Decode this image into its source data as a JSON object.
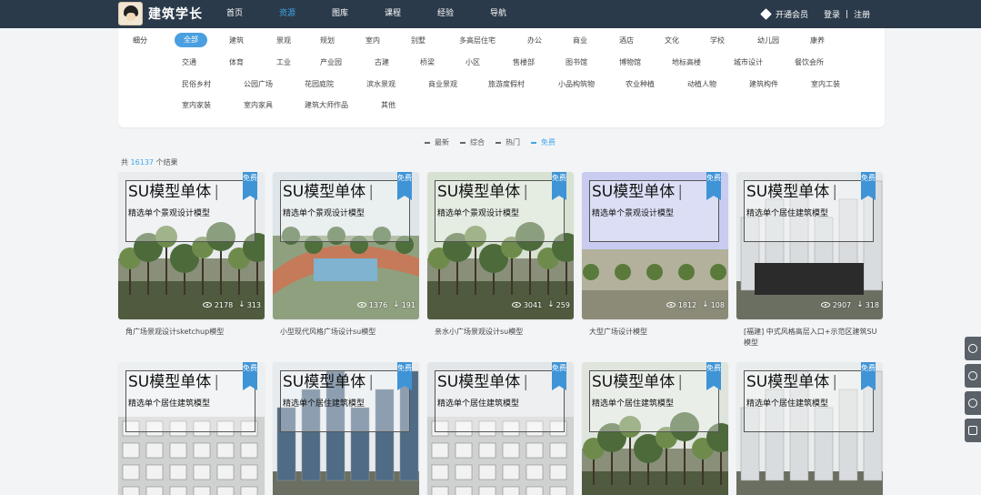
{
  "header": {
    "logo_text": "建筑学长",
    "nav": [
      "首页",
      "资源",
      "图库",
      "课程",
      "经验",
      "导航"
    ],
    "active_nav": 1,
    "vip_label": "开通会员",
    "login": "登录",
    "separator": "|",
    "register": "注册"
  },
  "filter": {
    "label": "细分",
    "rows": [
      [
        "全部",
        "建筑",
        "景观",
        "规划",
        "室内",
        "别墅",
        "多高层住宅",
        "办公",
        "商业",
        "酒店",
        "文化",
        "学校",
        "幼儿园",
        "康养"
      ],
      [
        "交通",
        "体育",
        "工业",
        "产业园",
        "古建",
        "桥梁",
        "小区",
        "售楼部",
        "图书馆",
        "博物馆",
        "地标高楼",
        "城市设计",
        "餐饮会所"
      ],
      [
        "民俗乡村",
        "公园广场",
        "花园庭院",
        "滨水景观",
        "商业景观",
        "旅游度假村",
        "小品构筑物",
        "农业种植",
        "动植人物",
        "建筑构件",
        "室内工装"
      ],
      [
        "室内家装",
        "室内家具",
        "建筑大师作品",
        "其他"
      ]
    ],
    "active": "全部"
  },
  "sort": {
    "items": [
      "最新",
      "综合",
      "热门",
      "免费"
    ],
    "active": "免费"
  },
  "result": {
    "prefix": "共",
    "count": "16137",
    "suffix": "个结果"
  },
  "cards": [
    {
      "title": "SU模型单体",
      "subtitle": "精选单个景观设计模型",
      "badge": "免费",
      "views": "2178",
      "downloads": "313",
      "caption": "角广场景观设计sketchup模型",
      "theme": "park"
    },
    {
      "title": "SU模型单体",
      "subtitle": "精选单个景观设计模型",
      "badge": "免费",
      "views": "1376",
      "downloads": "191",
      "caption": "小型现代风格广场设计su模型",
      "theme": "plaza"
    },
    {
      "title": "SU模型单体",
      "subtitle": "精选单个景观设计模型",
      "badge": "免费",
      "views": "3041",
      "downloads": "259",
      "caption": "亲水小广场景观设计su模型",
      "theme": "trees"
    },
    {
      "title": "SU模型单体",
      "subtitle": "精选单个景观设计模型",
      "badge": "免费",
      "views": "1812",
      "downloads": "108",
      "caption": "大型广场设计模型",
      "theme": "open"
    },
    {
      "title": "SU模型单体",
      "subtitle": "精选单个居住建筑模型",
      "badge": "免费",
      "views": "2907",
      "downloads": "318",
      "caption": "[福建] 中式风格高层入口+示范区建筑SU模型",
      "theme": "gate"
    },
    {
      "title": "SU模型单体",
      "subtitle": "精选单个居住建筑模型",
      "badge": "免费",
      "views": "",
      "downloads": "",
      "caption": "",
      "theme": "grid"
    },
    {
      "title": "SU模型单体",
      "subtitle": "精选单个居住建筑模型",
      "badge": "免费",
      "views": "",
      "downloads": "",
      "caption": "",
      "theme": "towers"
    },
    {
      "title": "SU模型单体",
      "subtitle": "精选单个居住建筑模型",
      "badge": "免费",
      "views": "",
      "downloads": "",
      "caption": "",
      "theme": "street"
    },
    {
      "title": "SU模型单体",
      "subtitle": "精选单个居住建筑模型",
      "badge": "免费",
      "views": "",
      "downloads": "",
      "caption": "",
      "theme": "aerial"
    },
    {
      "title": "SU模型单体",
      "subtitle": "精选单个居住建筑模型",
      "badge": "免费",
      "views": "",
      "downloads": "",
      "caption": "",
      "theme": "highrise"
    }
  ],
  "side_tools": [
    "coin-icon",
    "chat-icon",
    "headset-icon",
    "document-icon"
  ],
  "colors": {
    "accent": "#3fa6e8",
    "nav_bg": "#2b3a4a",
    "badge": "#3f94d6"
  }
}
